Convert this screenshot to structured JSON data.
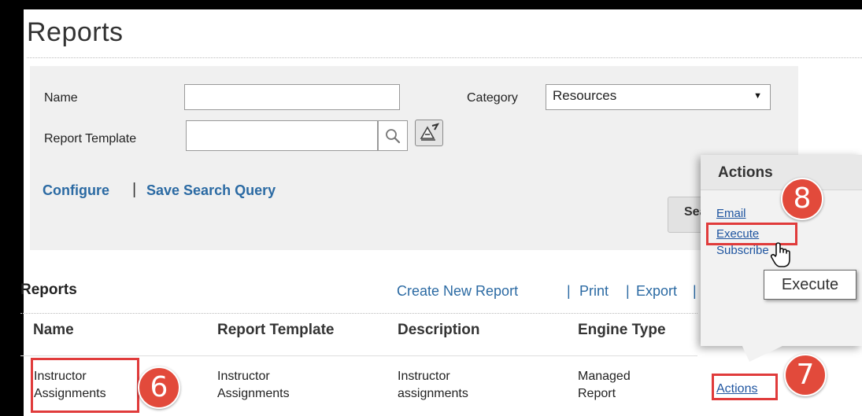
{
  "page": {
    "title": "Reports"
  },
  "search": {
    "name_label": "Name",
    "name_value": "",
    "category_label": "Category",
    "category_value": "Resources",
    "template_label": "Report Template",
    "template_value": "",
    "configure_link": "Configure",
    "separator": "|",
    "save_query_link": "Save Search Query",
    "search_button": "Search"
  },
  "reports": {
    "section_title": "Reports",
    "toolbar": {
      "create": "Create New Report",
      "print": "Print",
      "export": "Export",
      "separator": "|"
    },
    "columns": [
      "Name",
      "Report Template",
      "Description",
      "Engine Type"
    ],
    "rows": [
      {
        "name": "Instructor Assignments",
        "template": "Instructor Assignments",
        "description": "Instructor assignments",
        "engine_type": "Managed Report",
        "actions_link": "Actions"
      }
    ]
  },
  "actions_popover": {
    "title": "Actions",
    "items": [
      "Email",
      "Execute",
      "Subscribe"
    ]
  },
  "tooltip": {
    "text": "Execute"
  },
  "callouts": [
    "6",
    "7",
    "8"
  ],
  "colors": {
    "link": "#2b6aa3",
    "callout": "#e24a3b",
    "highlight": "#e03b3b",
    "panel": "#f0f0f0"
  },
  "icons": {
    "lookup": "magnifier-icon",
    "clear": "eraser-icon",
    "cursor": "hand-pointer-icon",
    "dropdown": "triangle-down-icon"
  }
}
